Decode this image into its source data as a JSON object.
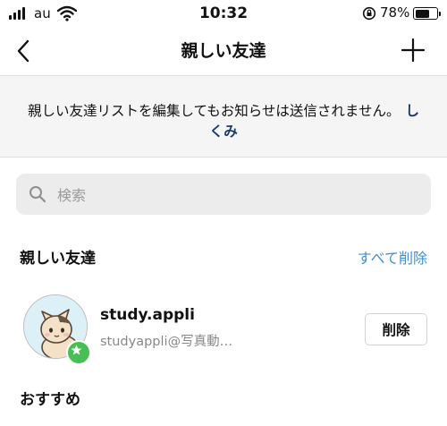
{
  "status_bar": {
    "carrier": "au",
    "time": "10:32",
    "battery": "78%",
    "battery_level": 0.78,
    "icons": [
      "signal-icon",
      "wifi-icon",
      "orientation-lock-icon",
      "battery-icon"
    ]
  },
  "header": {
    "title": "親しい友達",
    "back_icon": "chevron-left-icon",
    "add_icon": "plus-icon"
  },
  "info": {
    "text": "親しい友達リストを編集してもお知らせは送信されません。",
    "link": "しくみ"
  },
  "search": {
    "placeholder": "検索",
    "value": ""
  },
  "close_friends": {
    "title": "親しい友達",
    "remove_all_label": "すべて削除",
    "accent_color": "#3d8fd6",
    "items": [
      {
        "username": "study.appli",
        "subtitle": "studyappli@写真動…",
        "remove_label": "削除",
        "badge_icon": "star-icon",
        "badge_color": "#48bf55"
      }
    ]
  },
  "suggested": {
    "title": "おすすめ"
  }
}
